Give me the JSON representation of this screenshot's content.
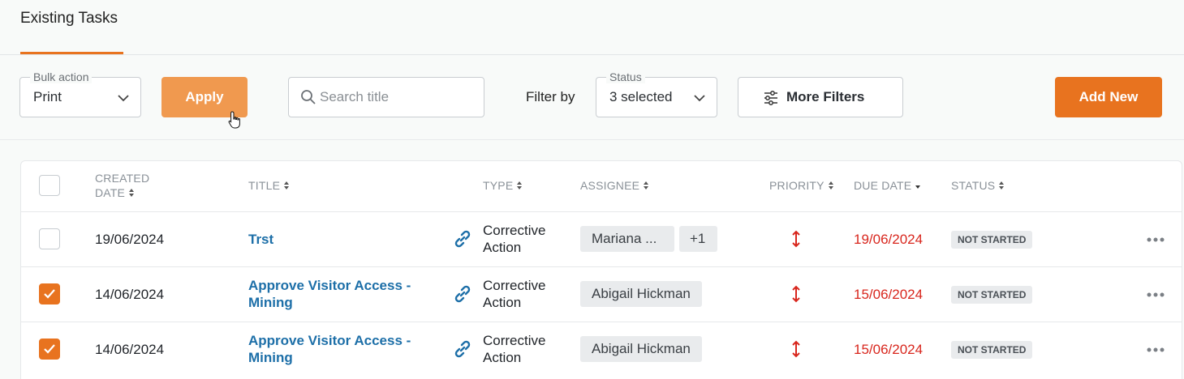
{
  "tabs": {
    "active_label": "Existing Tasks"
  },
  "toolbar": {
    "bulk_action_label": "Bulk action",
    "bulk_action_value": "Print",
    "apply_label": "Apply",
    "search_placeholder": "Search title",
    "filter_by_label": "Filter by",
    "status_label": "Status",
    "status_value": "3 selected",
    "more_filters_label": "More Filters",
    "add_new_label": "Add New"
  },
  "table": {
    "headers": {
      "created_date_line1": "CREATED",
      "created_date_line2": "DATE",
      "title": "TITLE",
      "type": "TYPE",
      "assignee": "ASSIGNEE",
      "priority": "PRIORITY",
      "due_date": "DUE DATE",
      "status": "STATUS"
    },
    "rows": [
      {
        "checked": false,
        "created": "19/06/2024",
        "title_line1": "Trst",
        "title_line2": "",
        "type_line1": "Corrective",
        "type_line2": "Action",
        "assignee": "Mariana ...",
        "assignee_extra": "+1",
        "due": "19/06/2024",
        "status": "NOT STARTED"
      },
      {
        "checked": true,
        "created": "14/06/2024",
        "title_line1": "Approve Visitor Access -",
        "title_line2": "Mining",
        "type_line1": "Corrective",
        "type_line2": "Action",
        "assignee": "Abigail Hickman",
        "assignee_extra": "",
        "due": "15/06/2024",
        "status": "NOT STARTED"
      },
      {
        "checked": true,
        "created": "14/06/2024",
        "title_line1": "Approve Visitor Access -",
        "title_line2": "Mining",
        "type_line1": "Corrective",
        "type_line2": "Action",
        "assignee": "Abigail Hickman",
        "assignee_extra": "",
        "due": "15/06/2024",
        "status": "NOT STARTED"
      }
    ]
  },
  "colors": {
    "accent": "#e8731f",
    "apply_button": "#f0994f",
    "link": "#1d6fa8",
    "due_date": "#d8261d"
  }
}
